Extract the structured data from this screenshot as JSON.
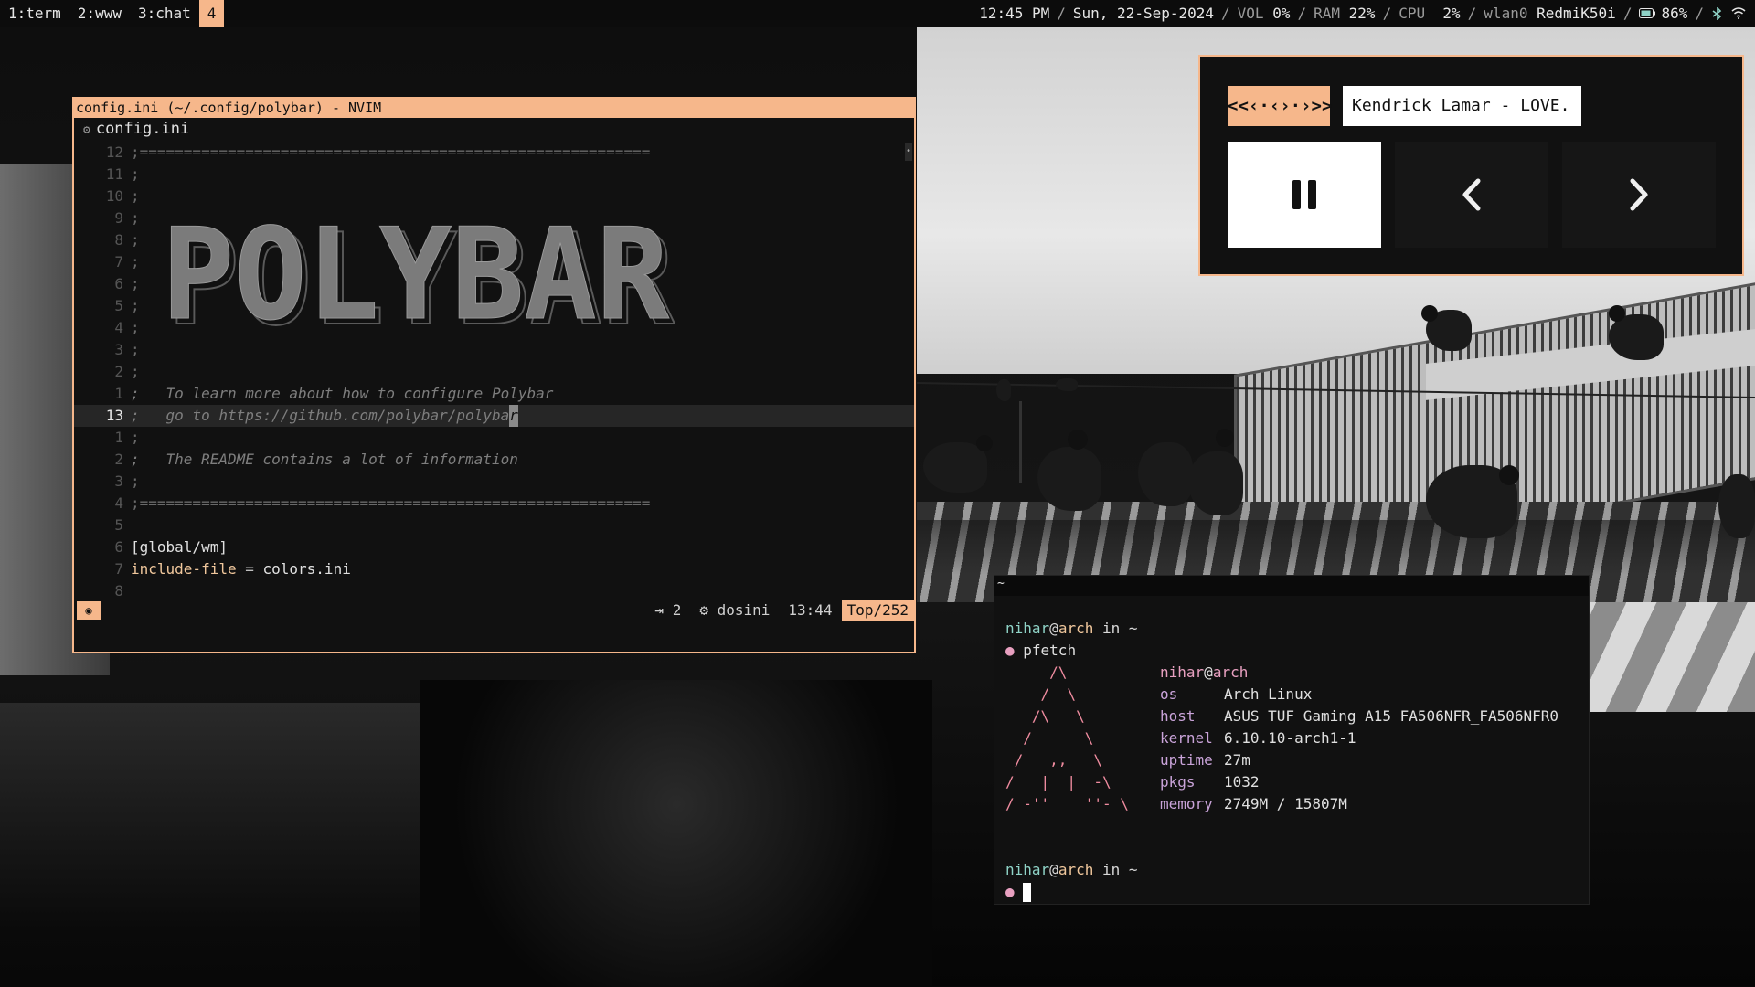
{
  "bar": {
    "workspaces": [
      {
        "label": "1:term",
        "active": false
      },
      {
        "label": "2:www",
        "active": false
      },
      {
        "label": "3:chat",
        "active": false
      },
      {
        "label": "4",
        "active": true
      }
    ],
    "time": "12:45 PM",
    "date": "Sun, 22-Sep-2024",
    "vol_label": "VOL",
    "vol_value": "0%",
    "ram_label": "RAM",
    "ram_value": "22%",
    "cpu_label": "CPU",
    "cpu_value": " 2%",
    "net_iface": "wlan0",
    "net_ssid": "RedmiK50i",
    "battery_value": "86%",
    "separator": "/"
  },
  "nvim": {
    "title": "config.ini (~/.config/polybar) - NVIM",
    "tab_label": "config.ini",
    "banner_text": "POLYBAR",
    "lines": [
      {
        "num": "12",
        "text": ";=========================================================="
      },
      {
        "num": "11",
        "text": ";"
      },
      {
        "num": "10",
        "text": ";"
      },
      {
        "num": "9",
        "text": ";"
      },
      {
        "num": "8",
        "text": ";"
      },
      {
        "num": "7",
        "text": ";"
      },
      {
        "num": "6",
        "text": ";"
      },
      {
        "num": "5",
        "text": ";"
      },
      {
        "num": "4",
        "text": ";"
      },
      {
        "num": "3",
        "text": ";"
      },
      {
        "num": "2",
        "text": ";"
      },
      {
        "num": "1",
        "text": ";   To learn more about how to configure Polybar"
      },
      {
        "num": "13",
        "text": ";   go to https://github.com/polybar/polyba",
        "cursor_char": "r"
      },
      {
        "num": "1",
        "text": ";"
      },
      {
        "num": "2",
        "text": ";   The README contains a lot of information"
      },
      {
        "num": "3",
        "text": ";"
      },
      {
        "num": "4",
        "text": ";=========================================================="
      },
      {
        "num": "5",
        "text": ""
      },
      {
        "num": "6",
        "section": "[global/wm]"
      },
      {
        "num": "7",
        "key": "include-file",
        "op": " = ",
        "value": "colors.ini"
      },
      {
        "num": "8",
        "text": ""
      }
    ],
    "status": {
      "mode_icon": "◉",
      "indent": "⇥ 2",
      "filetype": "⚙ dosini",
      "position": "13:44",
      "progress": "Top/252"
    }
  },
  "music": {
    "scroller": "<<‹·‹›·›>>",
    "track": "Kendrick Lamar - LOVE.",
    "buttons": {
      "pause": "pause-icon",
      "prev": "chevron-left-icon",
      "next": "chevron-right-icon"
    }
  },
  "terminal": {
    "title": "~",
    "prompt_user": "nihar",
    "prompt_at": "@",
    "prompt_host": "arch",
    "prompt_in": " in ",
    "prompt_dir": "~",
    "command_bullet": "●",
    "command": " pfetch",
    "ascii": [
      "     /\\",
      "    /  \\",
      "   /\\   \\",
      "  /      \\",
      " /   ,,   \\",
      "/   |  |  -\\",
      "/_-''    ''-_\\"
    ],
    "pfetch_header_user": "nihar",
    "pfetch_header_at": "@",
    "pfetch_header_host": "arch",
    "info": [
      {
        "label": "os",
        "value": "Arch Linux"
      },
      {
        "label": "host",
        "value": "ASUS TUF Gaming A15 FA506NFR_FA506NFR0"
      },
      {
        "label": "kernel",
        "value": "6.10.10-arch1-1"
      },
      {
        "label": "uptime",
        "value": "27m"
      },
      {
        "label": "pkgs",
        "value": "1032"
      },
      {
        "label": "memory",
        "value": "2749M / 15807M"
      }
    ]
  }
}
